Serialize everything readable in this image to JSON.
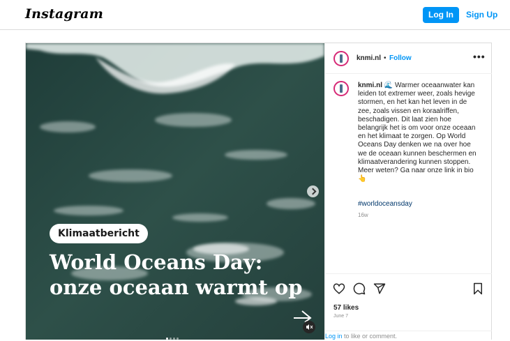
{
  "nav": {
    "logo": "Instagram",
    "login_label": "Log In",
    "signup_label": "Sign Up"
  },
  "media": {
    "tag": "Klimaatbericht",
    "headline": "World Oceans Day: onze oceaan warmt op",
    "carousel_dots": 4,
    "active_dot": 0
  },
  "post": {
    "username": "knmi.nl",
    "separator": "•",
    "follow_label": "Follow",
    "more_label": "•••",
    "caption_user": "knmi.nl",
    "caption_text": "🌊 Warmer oceaanwater kan leiden tot extremer weer, zoals hevige stormen, en het kan het leven in de zee, zoals vissen en koraalriffen, beschadigen. Dit laat zien hoe belangrijk het is om voor onze oceaan en het klimaat te zorgen. Op World Oceans Day denken we na over hoe we de oceaan kunnen beschermen en klimaatverandering kunnen stoppen. Meer weten? Ga naar onze link in bio 👆",
    "hashtag": "#worldoceansday",
    "age": "16w",
    "likes": "57 likes",
    "date": "June 7",
    "login_link": "Log in",
    "login_rest": " to like or comment."
  },
  "colors": {
    "accent": "#0095f6",
    "ocean": "#2c4a45",
    "border": "#dbdbdb"
  },
  "icons": [
    "heart-icon",
    "comment-icon",
    "share-icon",
    "bookmark-icon",
    "more-icon",
    "next-arrow-icon",
    "mute-icon"
  ]
}
